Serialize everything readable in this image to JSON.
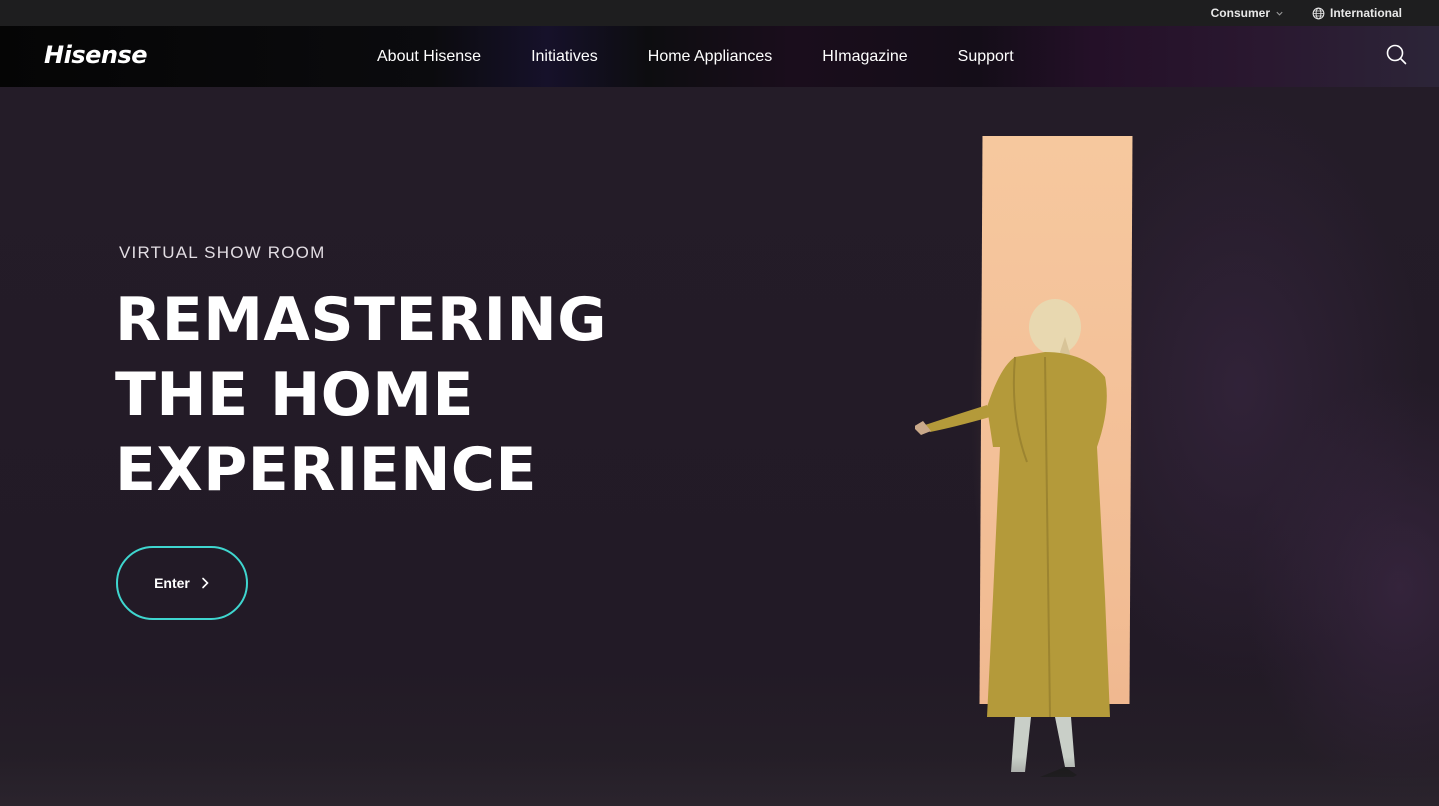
{
  "utility": {
    "consumer_label": "Consumer",
    "region_label": "International"
  },
  "nav": {
    "logo": "Hisense",
    "links": [
      "About Hisense",
      "Initiatives",
      "Home Appliances",
      "HImagazine",
      "Support"
    ]
  },
  "hero": {
    "eyebrow": "VIRTUAL SHOW ROOM",
    "headline_lines": [
      "REMASTERING",
      "THE HOME",
      "EXPERIENCE"
    ],
    "cta_label": "Enter"
  },
  "colors": {
    "accent": "#3fd6cf",
    "hero_bg": "#231b27",
    "door_light": "#f4c29a",
    "coat": "#b49a3a"
  },
  "icons": {
    "consumer_dropdown": "chevron-down-icon",
    "region": "globe-icon",
    "search": "search-icon",
    "cta_arrow": "chevron-right-icon"
  }
}
